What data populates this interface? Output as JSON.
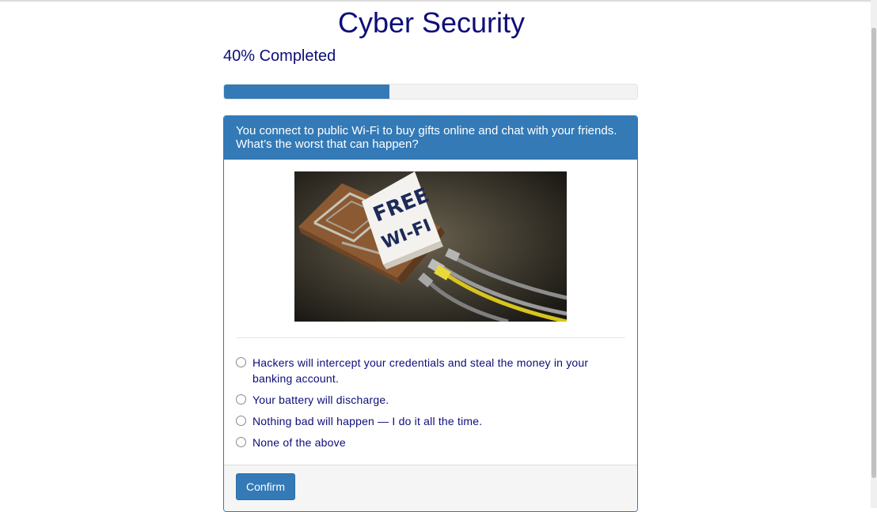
{
  "page": {
    "title": "Cyber Security",
    "progress_text": "40% Completed",
    "progress_fraction": 0.4
  },
  "question": {
    "text": "You connect to public Wi-Fi to buy gifts online and chat with your friends. What’s the worst that can happen?",
    "image": {
      "sign_line1": "FREE",
      "sign_line2": "WI-FI",
      "icon": "mousetrap-free-wifi-image"
    },
    "options": [
      "Hackers will intercept your credentials and steal the money in your banking account.",
      "Your battery will discharge.",
      "Nothing bad will happen — I do it all the time.",
      "None of the above"
    ]
  },
  "footer": {
    "confirm_label": "Confirm"
  },
  "colors": {
    "primary": "#337ab7",
    "title_text": "#0d0d7a",
    "track": "#f3f3f3"
  }
}
